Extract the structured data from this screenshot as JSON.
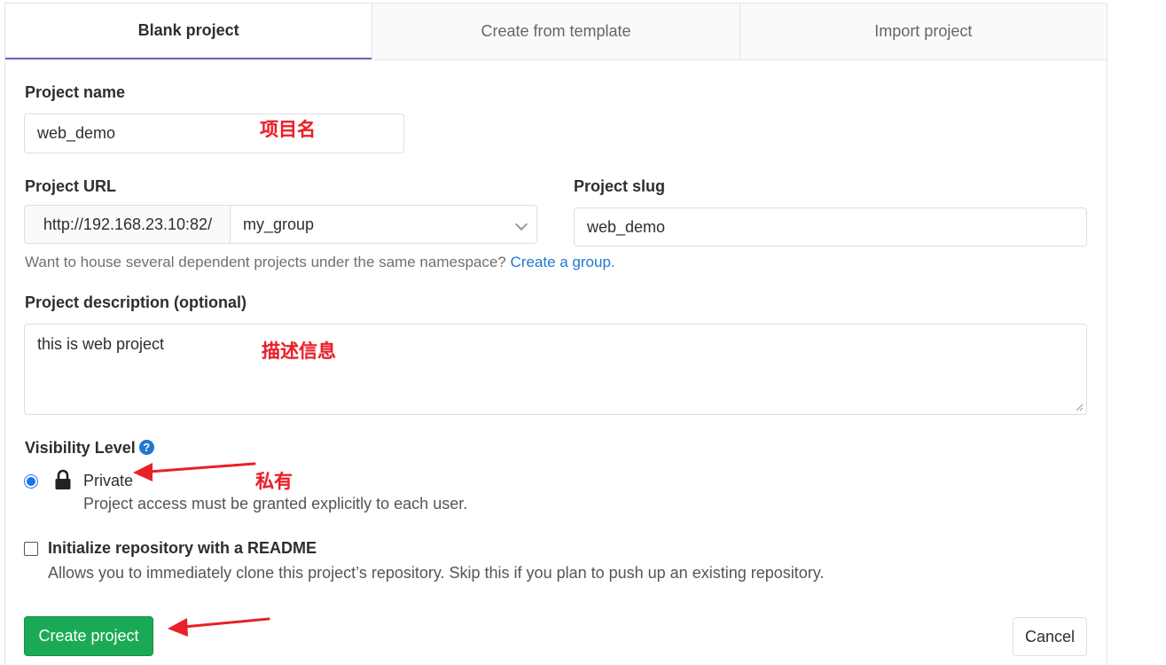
{
  "tabs": [
    {
      "label": "Blank project",
      "active": true
    },
    {
      "label": "Create from template",
      "active": false
    },
    {
      "label": "Import project",
      "active": false
    }
  ],
  "form": {
    "project_name_label": "Project name",
    "project_name_value": "web_demo",
    "project_url_label": "Project URL",
    "project_url_prefix": "http://192.168.23.10:82/",
    "namespace_value": "my_group",
    "project_slug_label": "Project slug",
    "project_slug_value": "web_demo",
    "help_text": "Want to house several dependent projects under the same namespace?",
    "help_link": "Create a group.",
    "description_label": "Project description (optional)",
    "description_value": "this is web project",
    "visibility_label": "Visibility Level",
    "help_icon": "?",
    "private_title": "Private",
    "private_desc": "Project access must be granted explicitly to each user.",
    "readme_title": "Initialize repository with a README",
    "readme_desc": "Allows you to immediately clone this project’s repository. Skip this if you plan to push up an existing repository."
  },
  "buttons": {
    "create": "Create project",
    "cancel": "Cancel"
  },
  "annotations": {
    "name": "项目名",
    "description": "描述信息",
    "private": "私有"
  },
  "colors": {
    "accent_tab": "#6666c4",
    "link": "#1f78d1",
    "create_button": "#1aaa55",
    "annotation": "#e8202a"
  },
  "icons": [
    "help-icon",
    "lock-icon",
    "chevron-down-icon"
  ]
}
